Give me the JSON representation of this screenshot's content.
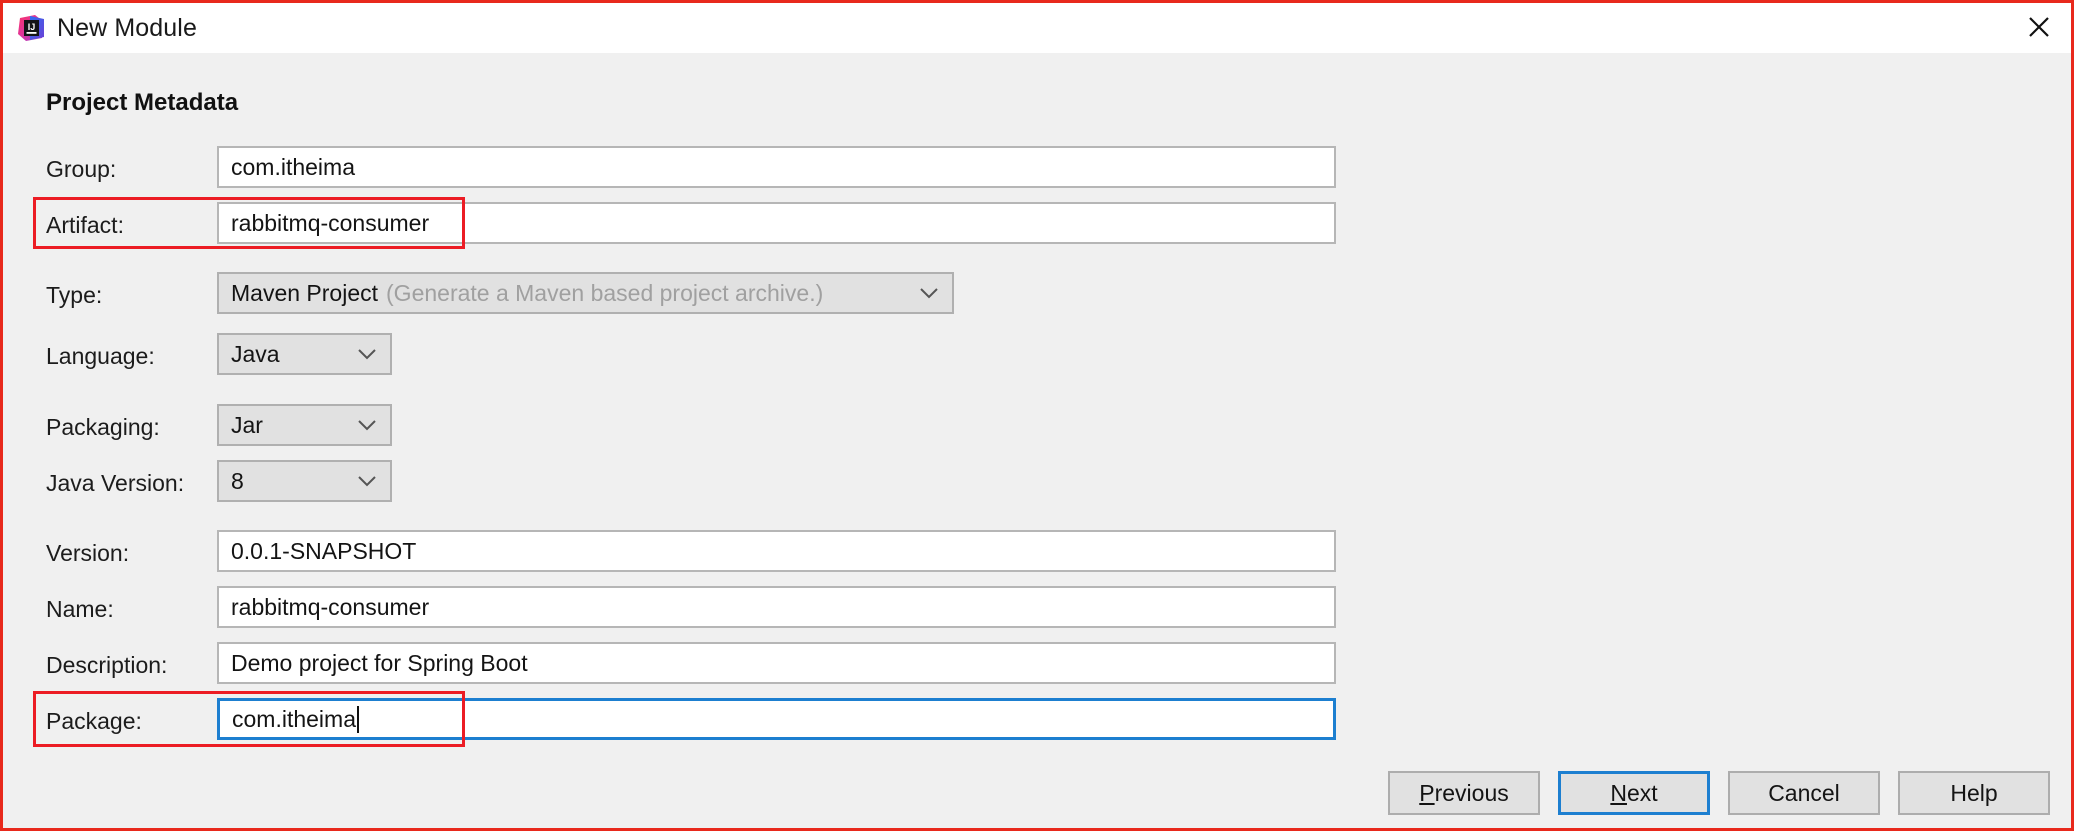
{
  "window": {
    "title": "New Module",
    "app_icon": "intellij-idea-icon",
    "close_icon": "close-icon"
  },
  "section": {
    "heading": "Project Metadata"
  },
  "fields": {
    "group": {
      "label": "Group:",
      "value": "com.itheima"
    },
    "artifact": {
      "label": "Artifact:",
      "value": "rabbitmq-consumer"
    },
    "type": {
      "label": "Type:",
      "value": "Maven Project",
      "hint": "(Generate a Maven based project archive.)"
    },
    "language": {
      "label": "Language:",
      "value": "Java"
    },
    "packaging": {
      "label": "Packaging:",
      "value": "Jar"
    },
    "java_version": {
      "label": "Java Version:",
      "value": "8"
    },
    "version": {
      "label": "Version:",
      "value": "0.0.1-SNAPSHOT"
    },
    "name": {
      "label": "Name:",
      "value": "rabbitmq-consumer"
    },
    "description": {
      "label": "Description:",
      "value": "Demo project for Spring Boot"
    },
    "package": {
      "label": "Package:",
      "value": "com.itheima"
    }
  },
  "buttons": {
    "previous": {
      "mnemonic": "P",
      "rest": "revious"
    },
    "next": {
      "mnemonic": "N",
      "rest": "ext"
    },
    "cancel": {
      "label": "Cancel"
    },
    "help": {
      "label": "Help"
    }
  },
  "colors": {
    "annotation_red": "#ec1c24",
    "focus_blue": "#1d7fd0",
    "panel_bg": "#f0f0f0",
    "field_bg": "#ffffff",
    "combo_bg": "#e1e1e1"
  }
}
